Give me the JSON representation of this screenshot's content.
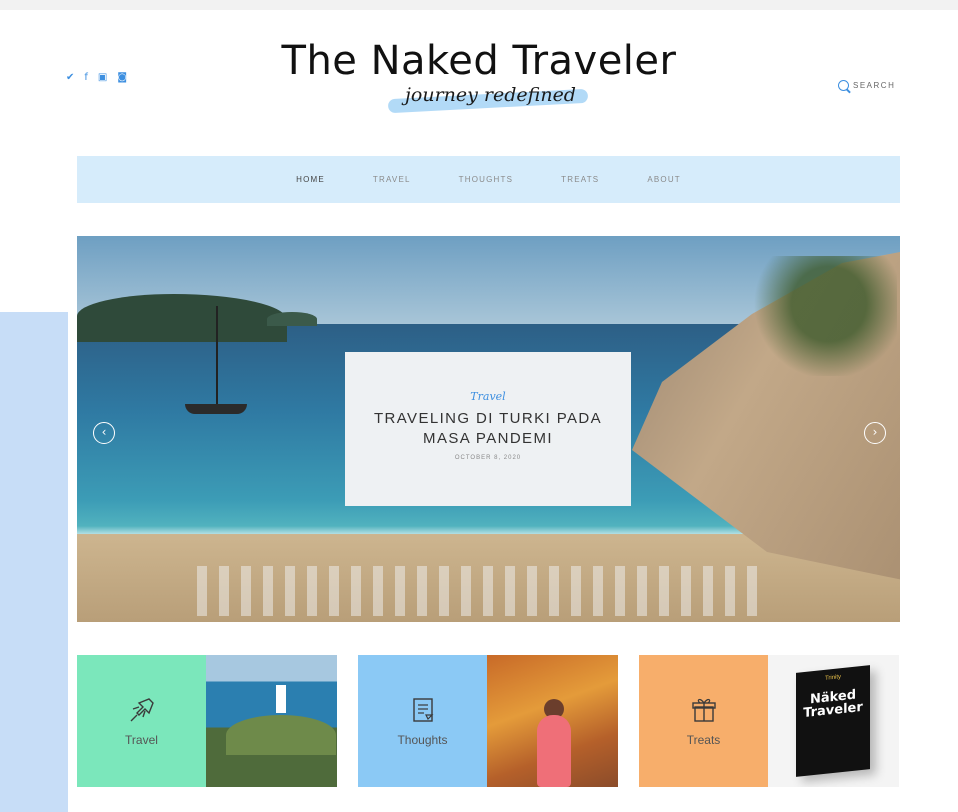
{
  "header": {
    "title": "The Naked Traveler",
    "tagline": "journey redefined",
    "search_label": "SEARCH",
    "social": [
      {
        "icon": "twitter-icon",
        "glyph": "✔"
      },
      {
        "icon": "facebook-icon",
        "glyph": "f"
      },
      {
        "icon": "youtube-icon",
        "glyph": "▣"
      },
      {
        "icon": "instagram-icon",
        "glyph": "◙"
      }
    ]
  },
  "nav": {
    "items": [
      {
        "label": "HOME",
        "active": true
      },
      {
        "label": "TRAVEL"
      },
      {
        "label": "THOUGHTS"
      },
      {
        "label": "TREATS"
      },
      {
        "label": "ABOUT"
      }
    ]
  },
  "hero": {
    "category": "Travel",
    "title": "TRAVELING DI TURKI PADA MASA PANDEMI",
    "date": "OCTOBER 8, 2020",
    "prev_glyph": "‹",
    "next_glyph": "›"
  },
  "categories": [
    {
      "label": "Travel",
      "icon": "airplane-icon",
      "color": "#7be7bb"
    },
    {
      "label": "Thoughts",
      "icon": "book-icon",
      "color": "#8bc9f5"
    },
    {
      "label": "Treats",
      "icon": "gift-icon",
      "color": "#f7ae6b"
    }
  ],
  "book": {
    "top_text": "Trinity",
    "title": "Näked Traveler"
  },
  "colors": {
    "accent": "#3d8fe0",
    "nav_bg": "#d6ecfb"
  }
}
